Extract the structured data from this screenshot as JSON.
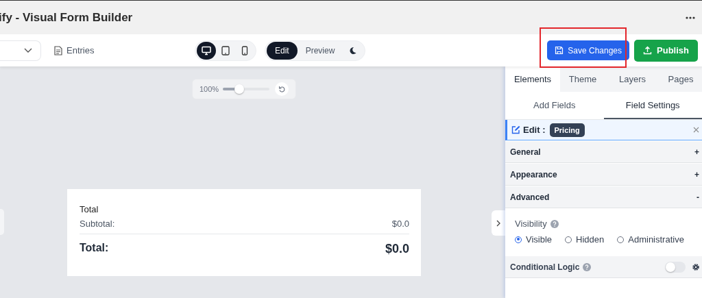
{
  "window": {
    "title": "ify - Visual Form Builder"
  },
  "toolbar": {
    "entries_label": "Entries",
    "devices": [
      {
        "kind": "desktop",
        "selected": true
      },
      {
        "kind": "tablet",
        "selected": false
      },
      {
        "kind": "mobile",
        "selected": false
      }
    ],
    "modes": [
      {
        "label": "Edit",
        "selected": true
      },
      {
        "label": "Preview",
        "selected": false
      }
    ],
    "save_button": {
      "label": "Save Changes",
      "highlighted": true
    },
    "publish_button": {
      "label": "Publish"
    }
  },
  "zoom": {
    "reading": "100%",
    "level": 0.35
  },
  "form": {
    "heading": "Total",
    "rows": [
      {
        "label": "Subtotal:",
        "value": "$0.0"
      }
    ],
    "total": {
      "label": "Total:",
      "value": "$0.0"
    }
  },
  "panel": {
    "tabs": [
      {
        "label": "Elements",
        "selected": true
      },
      {
        "label": "Theme",
        "selected": false
      },
      {
        "label": "Layers",
        "selected": false
      },
      {
        "label": "Pages",
        "selected": false
      }
    ],
    "subtabs": [
      {
        "label": "Add Fields",
        "selected": false
      },
      {
        "label": "Field Settings",
        "selected": true
      }
    ],
    "edit": {
      "label": "Edit :",
      "field": "Pricing"
    },
    "sections": [
      {
        "title": "General",
        "sign": "+"
      },
      {
        "title": "Appearance",
        "sign": "+"
      },
      {
        "title": "Advanced",
        "sign": "-"
      }
    ],
    "visibility": {
      "label": "Visibility",
      "options": [
        {
          "label": "Visible",
          "selected": true
        },
        {
          "label": "Hidden",
          "selected": false
        },
        {
          "label": "Administrative",
          "selected": false
        }
      ]
    },
    "conditional_logic": {
      "label": "Conditional Logic",
      "on": false
    }
  }
}
